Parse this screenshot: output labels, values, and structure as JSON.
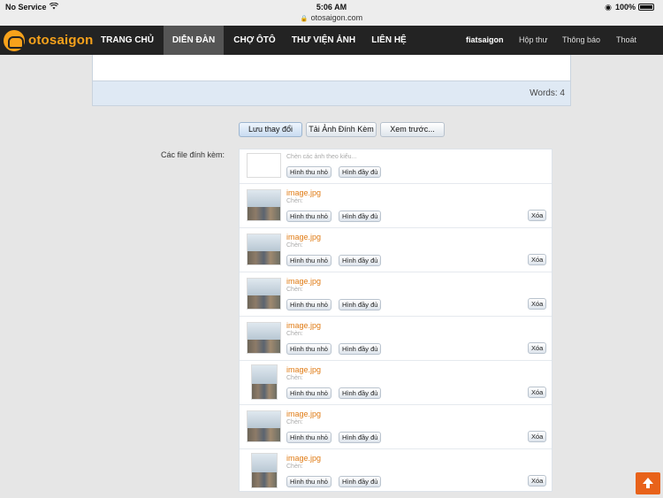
{
  "status_bar": {
    "carrier": "No Service",
    "time": "5:06 AM",
    "url": "otosaigon.com",
    "battery": "100%"
  },
  "nav": {
    "logo_text": "otosaigon",
    "items": [
      "TRANG CHỦ",
      "DIỄN ĐÀN",
      "CHỢ ÔTÔ",
      "THƯ VIỆN ẢNH",
      "LIÊN HỆ"
    ],
    "active": "DIỄN ĐÀN",
    "user": "fiatsaigon",
    "links": [
      "Hộp thư",
      "Thông báo",
      "Thoát"
    ]
  },
  "editor": {
    "word_count": "Words: 4"
  },
  "actions": {
    "save": "Lưu thay đổi",
    "upload": "Tải Ảnh Đính Kèm",
    "preview": "Xem trước..."
  },
  "attachments": {
    "label": "Các file đính kèm:",
    "insert_all_hint": "Chèn các ảnh theo kiểu...",
    "thumb_label": "Hình thu nhỏ",
    "full_label": "Hình đầy đủ",
    "insert_label": "Chèn:",
    "delete_label": "Xóa",
    "files": [
      {
        "name": "image.jpg"
      },
      {
        "name": "image.jpg"
      },
      {
        "name": "image.jpg"
      },
      {
        "name": "image.jpg"
      },
      {
        "name": "image.jpg"
      },
      {
        "name": "image.jpg"
      },
      {
        "name": "image.jpg"
      }
    ]
  },
  "colors": {
    "nav_bg": "#232323",
    "brand": "#f7a21b",
    "file_link": "#e07b14",
    "to_top": "#e8621a"
  }
}
